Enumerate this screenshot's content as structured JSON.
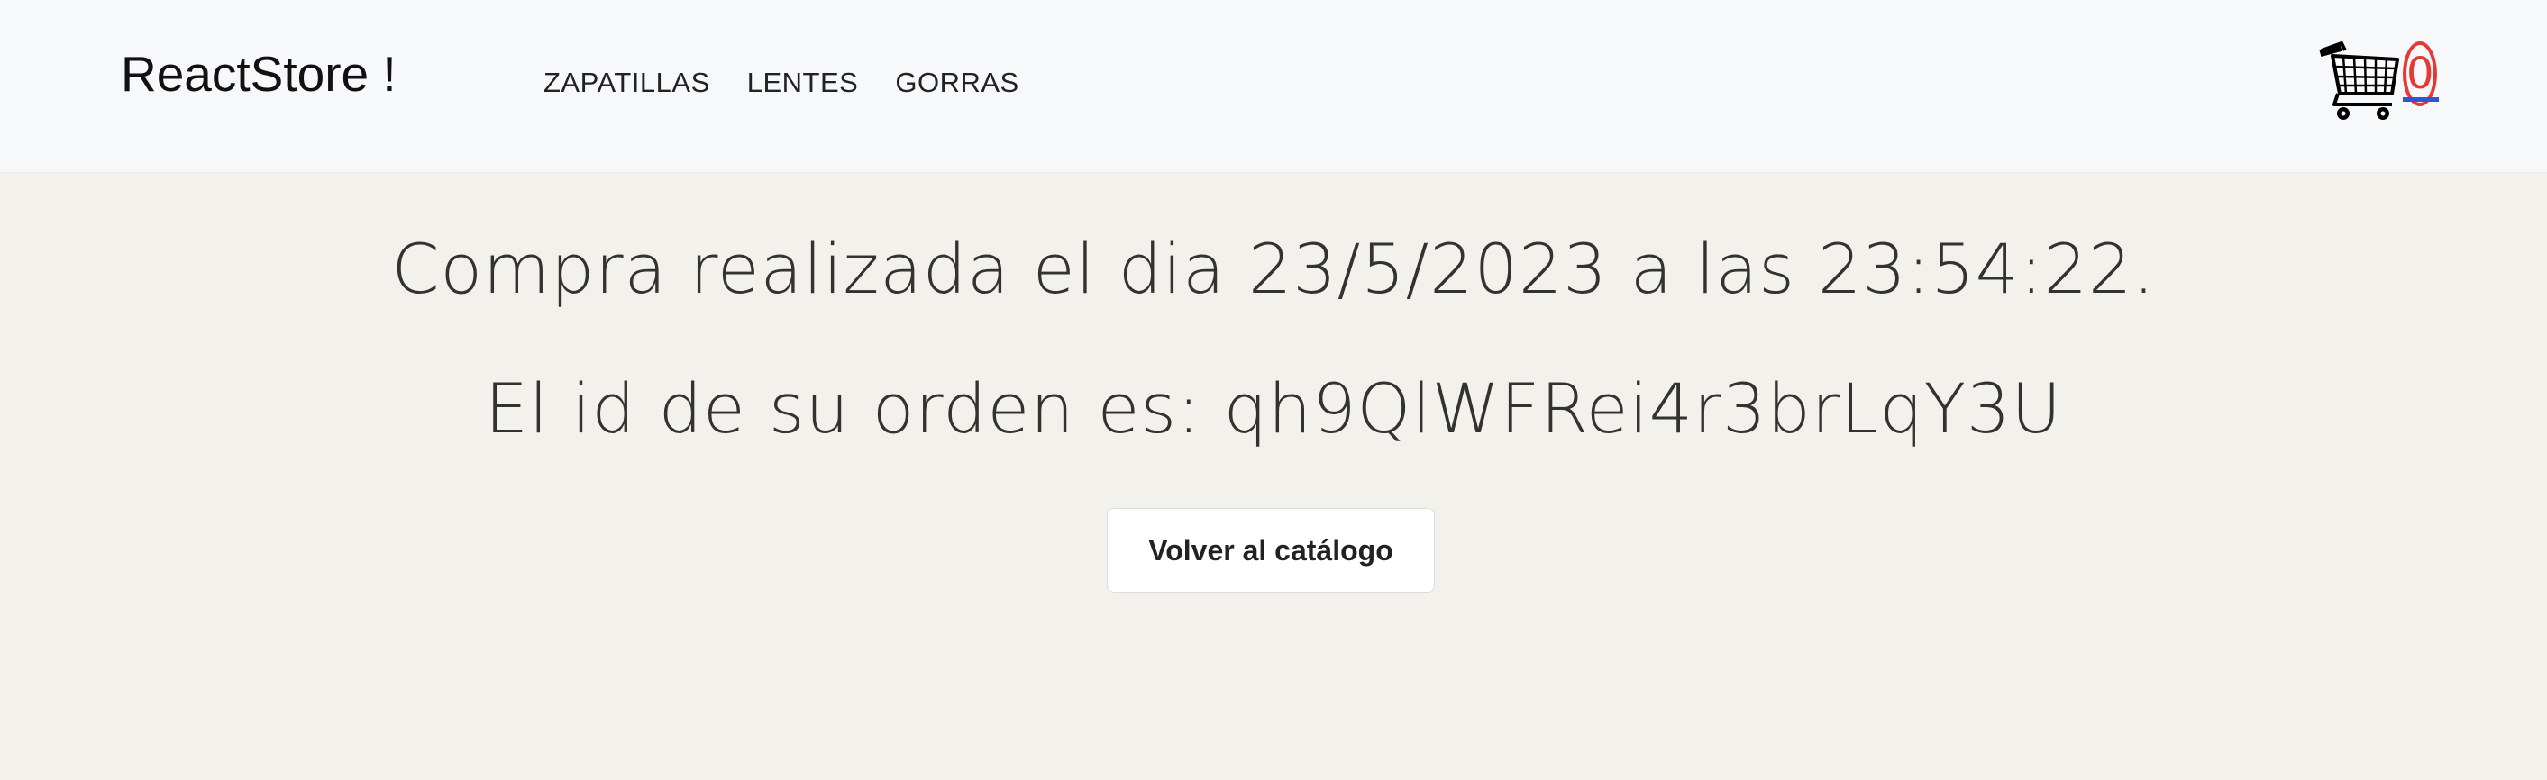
{
  "navbar": {
    "brand": "ReactStore !",
    "links": [
      "ZAPATILLAS",
      "LENTES",
      "GORRAS"
    ],
    "cart": {
      "icon": "shopping-cart-icon",
      "count": "0",
      "count_color": "#e53935"
    }
  },
  "main": {
    "purchase_message": "Compra realizada el dia 23/5/2023 a las 23:54:22.",
    "order_message": "El id de su orden es: qh9QlWFRei4r3brLqY3U",
    "back_button_label": "Volver al catálogo"
  }
}
